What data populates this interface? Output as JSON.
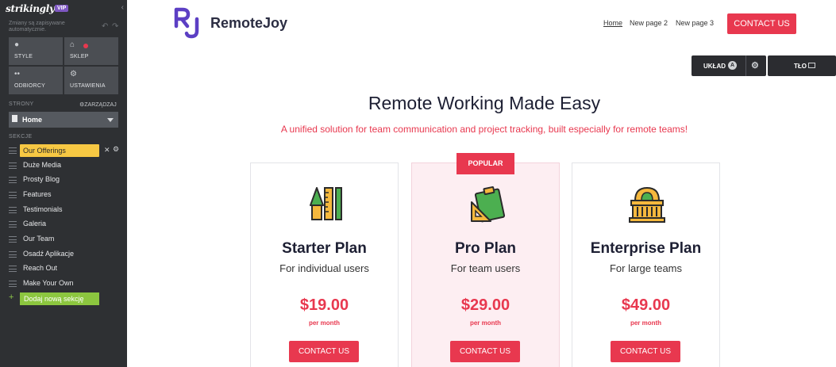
{
  "editor": {
    "logo": "strikingly",
    "vip": "VIP",
    "saved_note": "Zmiany są zapisywane automatycznie.",
    "tiles": [
      {
        "label": "STYLE",
        "icon": "palette-icon"
      },
      {
        "label": "SKLEP",
        "icon": "basket-icon"
      },
      {
        "label": "ODBIORCY",
        "icon": "people-icon"
      },
      {
        "label": "USTAWIENIA",
        "icon": "gear-icon"
      }
    ],
    "pages_label": "STRONY",
    "manage_label": "ZARZĄDZAJ",
    "current_page": "Home",
    "sections_label": "SEKCJE",
    "sections": [
      "Our Offerings",
      "Duże Media",
      "Prosty Blog",
      "Features",
      "Testimonials",
      "Galeria",
      "Our Team",
      "Osadź Aplikacje",
      "Reach Out",
      "Make Your Own"
    ],
    "add_section": "Dodaj nową sekcję",
    "layout_button": "UKŁAD",
    "layout_badge": "A",
    "background_button": "TŁO"
  },
  "site": {
    "brand": "RemoteJoy",
    "nav": [
      "Home",
      "New page 2",
      "New page 3"
    ],
    "header_cta": "CONTACT US",
    "hero_title": "Remote Working Made Easy",
    "hero_subtitle": "A unified solution for team communication and project tracking, built especially for remote teams!",
    "popular_badge": "POPULAR",
    "plans": [
      {
        "name": "Starter Plan",
        "audience": "For individual users",
        "price": "$19.00",
        "period": "per month",
        "cta": "CONTACT US",
        "icon": "pen-ruler-icon"
      },
      {
        "name": "Pro Plan",
        "audience": "For team users",
        "price": "$29.00",
        "period": "per month",
        "cta": "CONTACT US",
        "icon": "clipboard-icon"
      },
      {
        "name": "Enterprise Plan",
        "audience": "For large teams",
        "price": "$49.00",
        "period": "per month",
        "cta": "CONTACT US",
        "icon": "building-icon"
      }
    ],
    "colors": {
      "accent": "#e8384f",
      "brand": "#5c3fc4",
      "popular_bg": "#fdeef2",
      "sidebar_bg": "#2e3033",
      "active_section": "#f7c843",
      "add_section": "#8cc63f"
    }
  }
}
